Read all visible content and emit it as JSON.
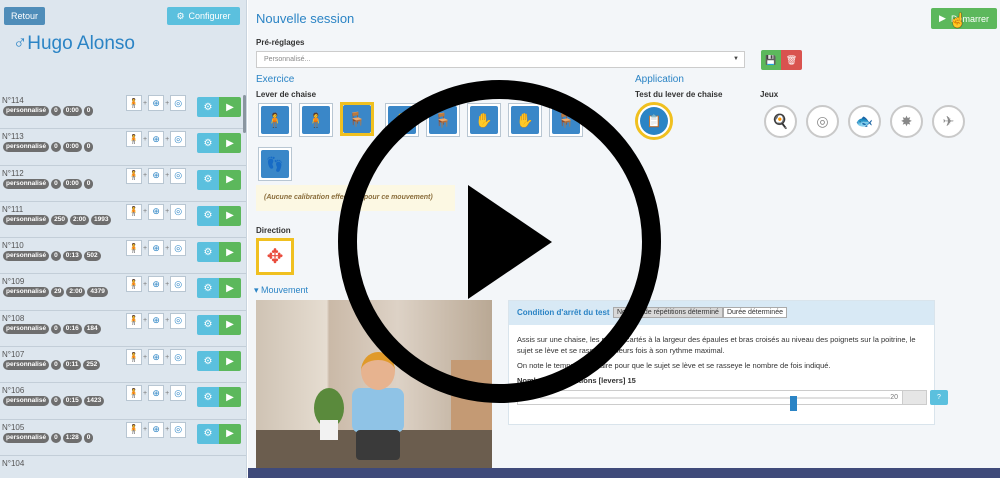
{
  "sidebar": {
    "back_label": "Retour",
    "configure_label": "Configurer",
    "user_name": "♂Hugo Alonso",
    "sessions": [
      {
        "number": "N°114",
        "badges": [
          "personnalisé",
          "0",
          "0:00",
          "0"
        ]
      },
      {
        "number": "N°113",
        "badges": [
          "personnalisé",
          "0",
          "0:00",
          "0"
        ]
      },
      {
        "number": "N°112",
        "badges": [
          "personnalisé",
          "0",
          "0:00",
          "0"
        ]
      },
      {
        "number": "N°111",
        "badges": [
          "personnalisé",
          "250",
          "2:00",
          "1993"
        ]
      },
      {
        "number": "N°110",
        "badges": [
          "personnalisé",
          "0",
          "0:13",
          "502"
        ]
      },
      {
        "number": "N°109",
        "badges": [
          "personnalisé",
          "29",
          "2:00",
          "4379"
        ]
      },
      {
        "number": "N°108",
        "badges": [
          "personnalisé",
          "0",
          "0:16",
          "184"
        ]
      },
      {
        "number": "N°107",
        "badges": [
          "personnalisé",
          "0",
          "0:11",
          "252"
        ]
      },
      {
        "number": "N°106",
        "badges": [
          "personnalisé",
          "0",
          "0:15",
          "1423"
        ]
      },
      {
        "number": "N°105",
        "badges": [
          "personnalisé",
          "0",
          "1:28",
          "0"
        ]
      },
      {
        "number": "N°104",
        "badges": []
      }
    ]
  },
  "main": {
    "title": "Nouvelle session",
    "start_label": "Démarrer",
    "presets_label": "Pré-réglages",
    "presets_value": "Personnalisé...",
    "exercise_heading": "Exercice",
    "exercise_sub": "Lever de chaise",
    "application_heading": "Application",
    "application_sub": "Test du lever de chaise",
    "games_sub": "Jeux",
    "calibration_msg": "(Aucune calibration effectuée pour ce mouvement)",
    "direction_label": "Direction",
    "movement_label": "Mouvement"
  },
  "condition": {
    "title": "Condition d'arrêt du test",
    "tabs": [
      "Nombre de répétitions déterminé",
      "Durée déterminée"
    ],
    "description": "Assis sur une chaise, les pieds écartés à la largeur des épaules et bras croisés au niveau des poignets sur la poitrine, le sujet se lève et se rassoit plusieurs fois à son rythme maximal.",
    "note": "On note le temps nécessaire pour que le sujet se lève et se rasseye le nombre de fois indiqué.",
    "reps_label": "Nombre de répétitions [levers] 15",
    "slider_min": "0",
    "slider_max": "20",
    "slider_value": 15
  },
  "colors": {
    "accent": "#2b84c5",
    "success": "#5cb85c",
    "info": "#5bc0de",
    "danger": "#d9534f",
    "selected_border": "#f0c020"
  }
}
